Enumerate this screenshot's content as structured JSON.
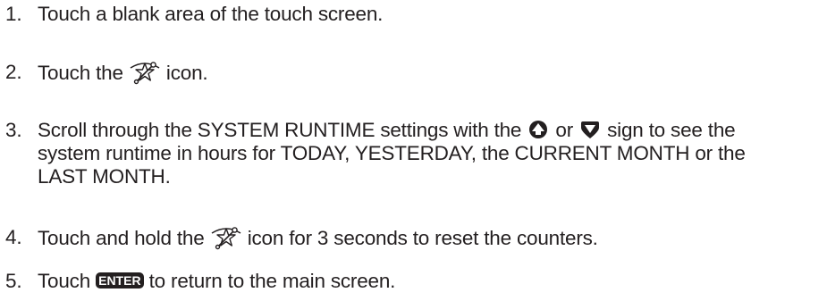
{
  "steps": [
    {
      "number": "1.",
      "text": "Touch a blank area of the touch screen."
    },
    {
      "number": "2.",
      "before": "Touch the",
      "after": "icon."
    },
    {
      "number": "3.",
      "line1_before": "Scroll through the SYSTEM RUNTIME settings with the",
      "line1_or": "or",
      "line1_after": "sign to see the",
      "line2": "system runtime in hours for TODAY, YESTERDAY, the CURRENT MONTH or the",
      "line3": "LAST MONTH."
    },
    {
      "number": "4.",
      "before": "Touch and hold the",
      "after": "icon for 3 seconds to reset the counters."
    },
    {
      "number": "5.",
      "before": "Touch",
      "button_label": "ENTER",
      "after": "to return to the main screen."
    }
  ],
  "icons": {
    "settings": "star-wrench-icon",
    "up": "up-arrow-circle-icon",
    "down": "down-arrow-shield-icon"
  }
}
